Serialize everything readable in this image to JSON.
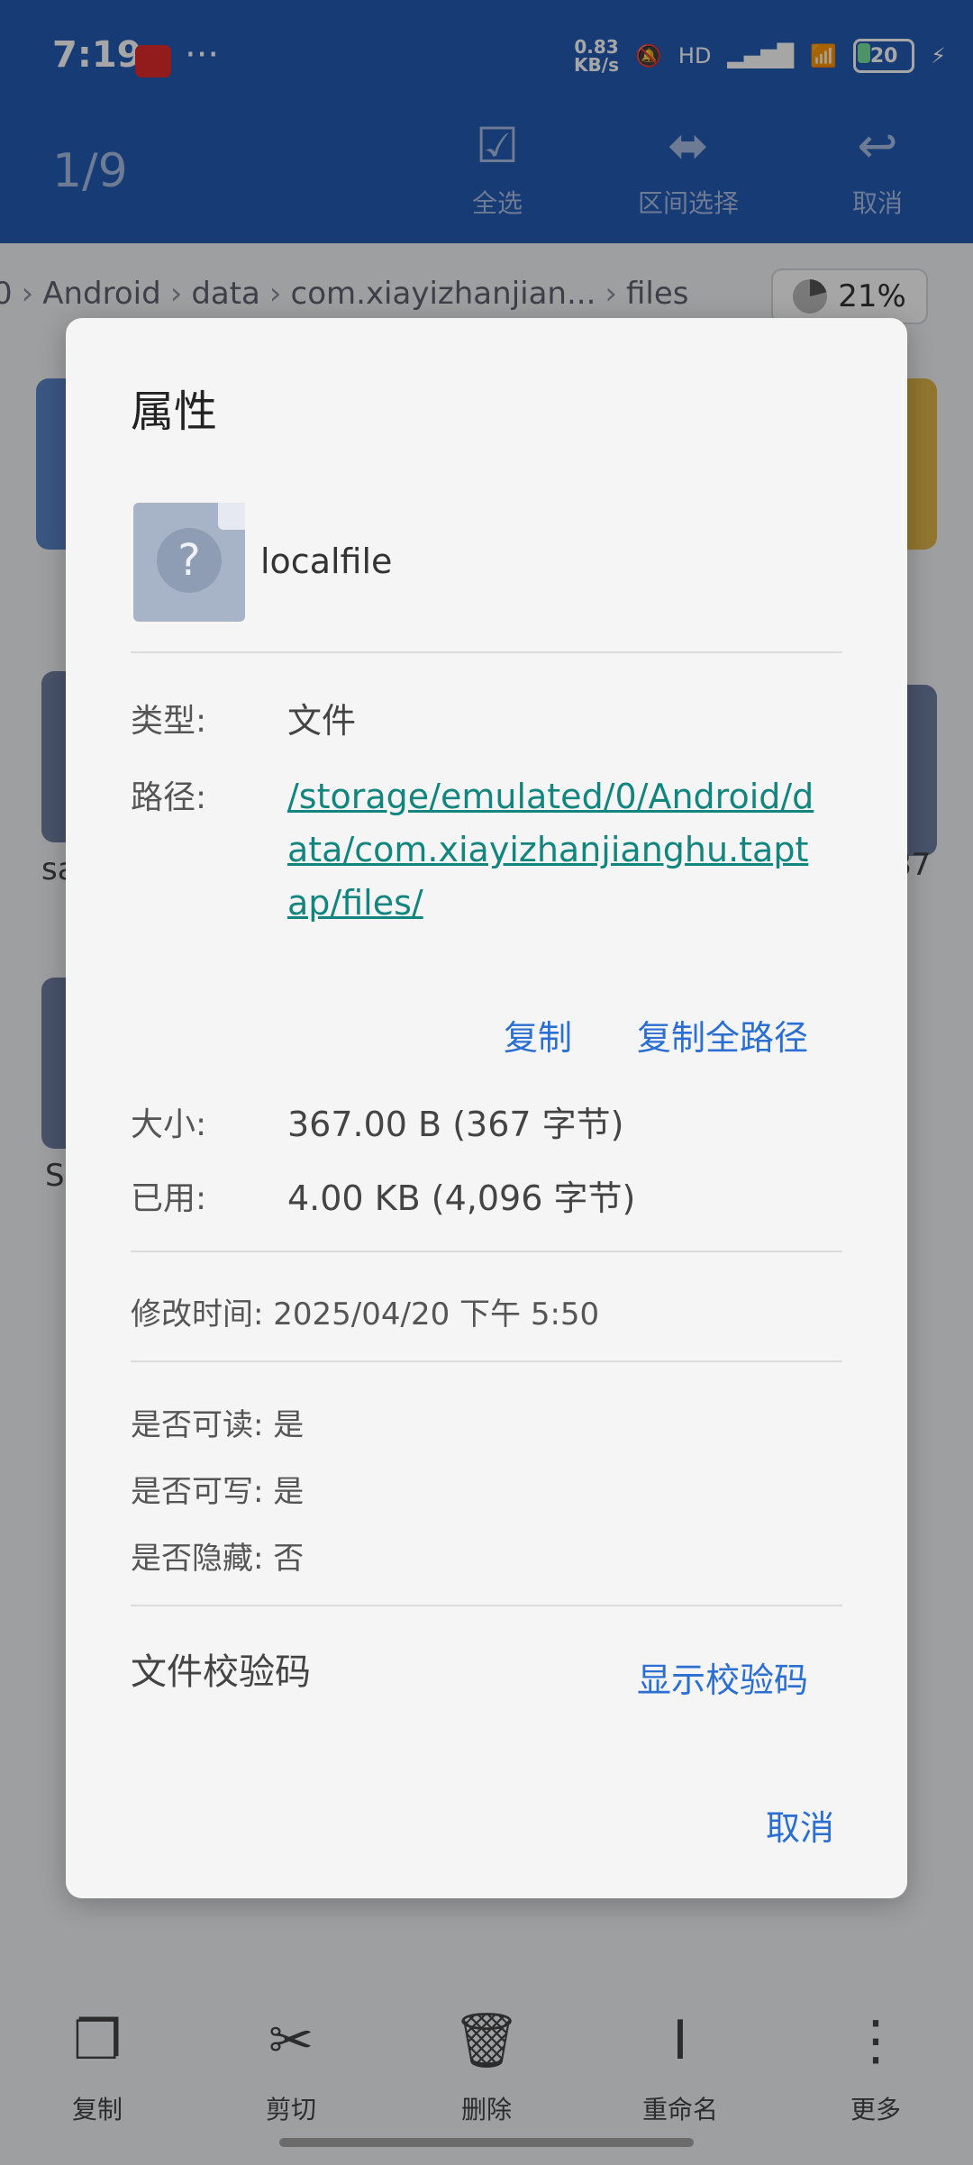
{
  "status_bar": {
    "time": "7:19",
    "net_speed_value": "0.83",
    "net_speed_unit": "KB/s",
    "hd_label": "HD",
    "battery": "20"
  },
  "action_bar": {
    "selection_count": "1/9",
    "select_all_label": "全选",
    "range_select_label": "区间选择",
    "cancel_label": "取消"
  },
  "breadcrumb": {
    "items": [
      "0",
      "Android",
      "data",
      "com.xiayizhanjian...",
      "files"
    ],
    "storage_percent": "21%"
  },
  "background": {
    "labels": [
      "sa",
      "S",
      "87"
    ]
  },
  "dialog": {
    "title": "属性",
    "file_name": "localfile",
    "type_label": "类型:",
    "type_value": "文件",
    "path_label": "路径:",
    "path_value": "/storage/emulated/0/Android/data/com.xiayizhanjianghu.taptap/files/",
    "copy_label": "复制",
    "copy_full_path_label": "复制全路径",
    "size_label": "大小:",
    "size_value": "367.00 B (367 字节)",
    "used_label": "已用:",
    "used_value": "4.00 KB (4,096 字节)",
    "modified_line": "修改时间: 2025/04/20 下午 5:50",
    "readable_line": "是否可读: 是",
    "writable_line": "是否可写: 是",
    "hidden_line": "是否隐藏: 否",
    "checksum_label": "文件校验码",
    "show_checksum_label": "显示校验码",
    "cancel_label": "取消"
  },
  "bottom_toolbar": {
    "copy_label": "复制",
    "cut_label": "剪切",
    "delete_label": "删除",
    "rename_label": "重命名",
    "more_label": "更多"
  },
  "colors": {
    "action_bar": "#245bb4",
    "link_teal": "#13857f",
    "button_blue": "#2a6fd1"
  }
}
